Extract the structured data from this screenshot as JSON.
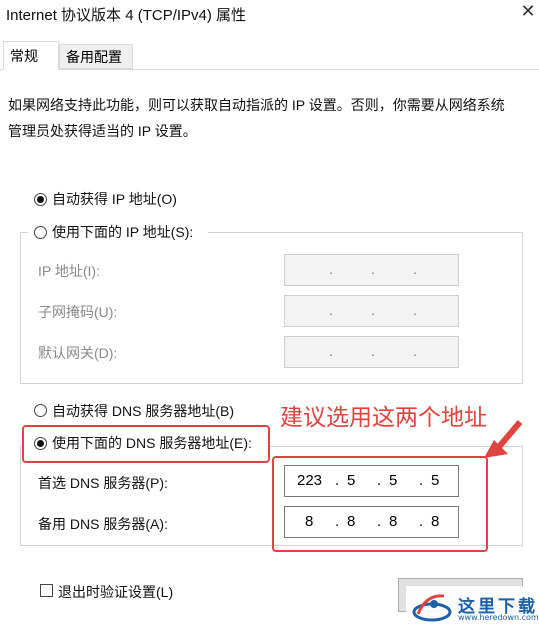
{
  "window": {
    "title": "Internet 协议版本 4 (TCP/IPv4) 属性",
    "close_glyph": "✕"
  },
  "tabs": [
    {
      "label": "常规"
    },
    {
      "label": "备用配置"
    }
  ],
  "description": "如果网络支持此功能，则可以获取自动指派的 IP 设置。否则，你需要从网络系统管理员处获得适当的 IP 设置。",
  "ip": {
    "auto_label": "自动获得 IP 地址(O)",
    "manual_label": "使用下面的 IP 地址(S):",
    "selected": "auto",
    "fields": [
      {
        "label": "IP 地址(I):",
        "value": ". . ."
      },
      {
        "label": "子网掩码(U):",
        "value": ". . ."
      },
      {
        "label": "默认网关(D):",
        "value": ". . ."
      }
    ]
  },
  "dns": {
    "auto_label": "自动获得 DNS 服务器地址(B)",
    "manual_label": "使用下面的 DNS 服务器地址(E):",
    "selected": "manual",
    "preferred": {
      "label": "首选 DNS 服务器(P):",
      "octets": [
        "223",
        "5",
        "5",
        "5"
      ]
    },
    "alternate": {
      "label": "备用 DNS 服务器(A):",
      "octets": [
        "8",
        "8",
        "8",
        "8"
      ]
    }
  },
  "annotation": {
    "text": "建议选用这两个地址",
    "color": "#e0443e"
  },
  "validate": {
    "label": "退出时验证设置(L)",
    "checked": false
  },
  "watermark": {
    "text": "这里下载",
    "url": "www.heredown.com"
  }
}
